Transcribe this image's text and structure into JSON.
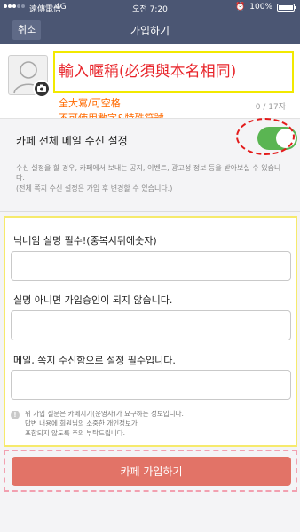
{
  "status": {
    "carrier": "遠傳電信",
    "network": "4G",
    "time": "오전 7:20",
    "battery": "100%"
  },
  "header": {
    "cancel_label": "취소",
    "title": "가입하기"
  },
  "profile": {
    "nickname_placeholder": "輸入暱稱(必須與本名相同)",
    "note_line1": "全大寫/可空格",
    "note_line2": "不可使用數字&特殊符號",
    "counter": "0 / 17자"
  },
  "mail_setting": {
    "label": "카페 전체 메일 수신 설정",
    "enabled": true,
    "description": "수신 설정을 할 경우, 카페에서 보내는 공지, 이벤트, 광고성 정보 등을 받아보실 수 있습니다.",
    "note": "(전체 쪽지 수신 설정은 가입 후 변경할 수 있습니다.)"
  },
  "questions": {
    "items": [
      {
        "label": "닉네임 실명 필수!(중복시뒤에숫자)",
        "value": ""
      },
      {
        "label": "실명 아니면 가입승인이 되지 않습니다.",
        "value": ""
      },
      {
        "label": "메일, 쪽지 수신함으로 설정 필수입니다.",
        "value": ""
      }
    ],
    "info_line1": "위 가입 질문은 카페지기(운영자)가 요구하는 정보입니다.",
    "info_line2": "답변 내용에 회원님의 소중한 개인정보가",
    "info_line3": "포함되지 않도록 주의 부탁드립니다."
  },
  "submit": {
    "label": "카페 가입하기"
  },
  "colors": {
    "header_bg": "#4b5673",
    "toggle_on": "#5ab552",
    "submit_bg": "#e27367",
    "annotation_red": "#e8242a",
    "annotation_orange": "#ff6a00"
  }
}
